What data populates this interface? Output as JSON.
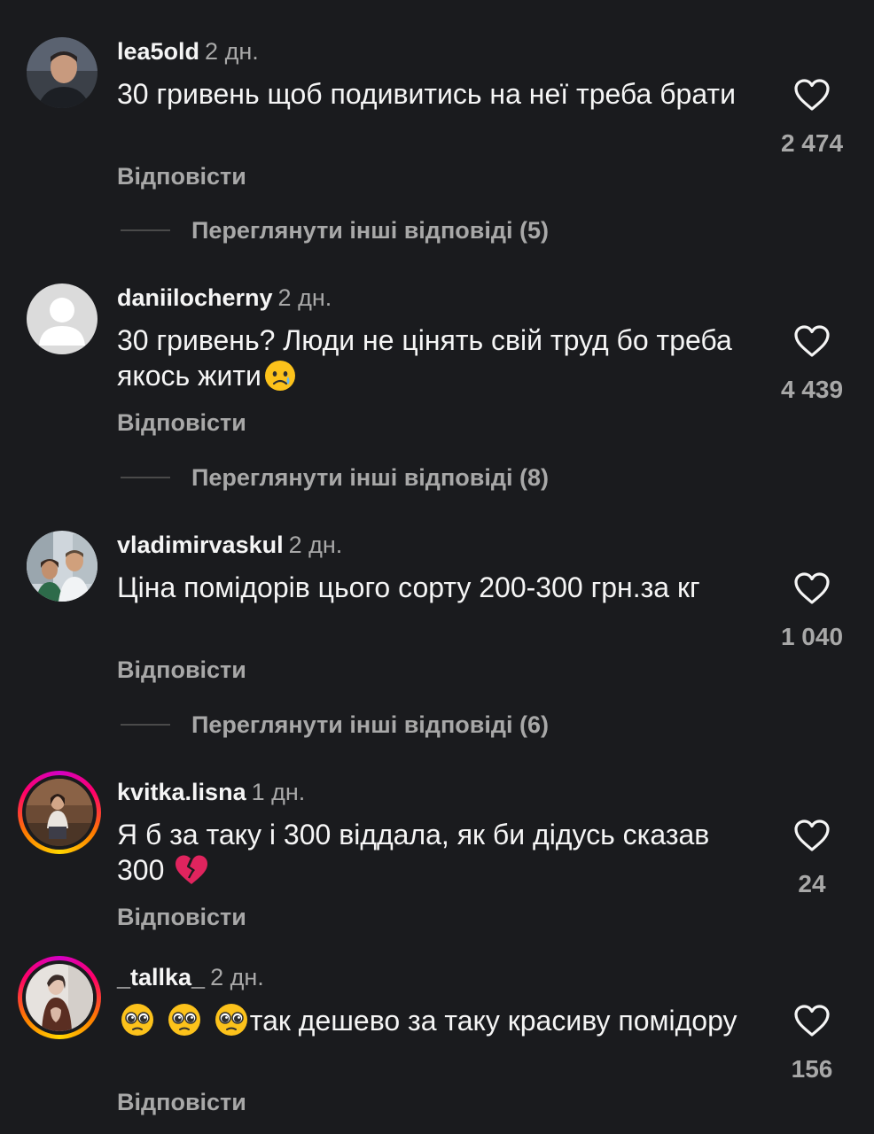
{
  "comments": [
    {
      "username": "lea5old",
      "time": "2 дн.",
      "text": "30 гривень щоб подивитись на неї треба брати",
      "reply_label": "Відповісти",
      "likes": "2 474",
      "more_replies": "Переглянути інші відповіді (5)",
      "avatar_icon": "profile-photo"
    },
    {
      "username": "daniilocherny",
      "time": "2 дн.",
      "text": "30 гривень? Люди не  цінять свій труд бо треба якось жити",
      "emoji": "crying-face-emoji",
      "reply_label": "Відповісти",
      "likes": "4 439",
      "more_replies": "Переглянути інші відповіді (8)",
      "avatar_icon": "default-avatar"
    },
    {
      "username": "vladimirvaskul",
      "time": "2 дн.",
      "text": "Ціна помідорів цього сорту 200-300 грн.за кг",
      "reply_label": "Відповісти",
      "likes": "1 040",
      "more_replies": "Переглянути інші відповіді (6)",
      "avatar_icon": "profile-photo"
    },
    {
      "username": "kvitka.lisna",
      "time": "1 дн.",
      "text": "Я б за таку і 300 віддала, як би дідусь сказав 300",
      "emoji": "broken-heart-emoji",
      "reply_label": "Відповісти",
      "likes": "24",
      "avatar_icon": "profile-photo-story-ring"
    },
    {
      "username": "_tallka_",
      "time": "2 дн.",
      "text": "так дешево за таку красиву помідору",
      "emoji": "pleading-face-emoji",
      "reply_label": "Відповісти",
      "likes": "156",
      "avatar_icon": "profile-photo-story-ring"
    }
  ],
  "colors": {
    "background": "#1a1b1e",
    "text_primary": "#f5f5f5",
    "text_secondary": "#a8a8a8",
    "story_ring": "#ff0069"
  }
}
